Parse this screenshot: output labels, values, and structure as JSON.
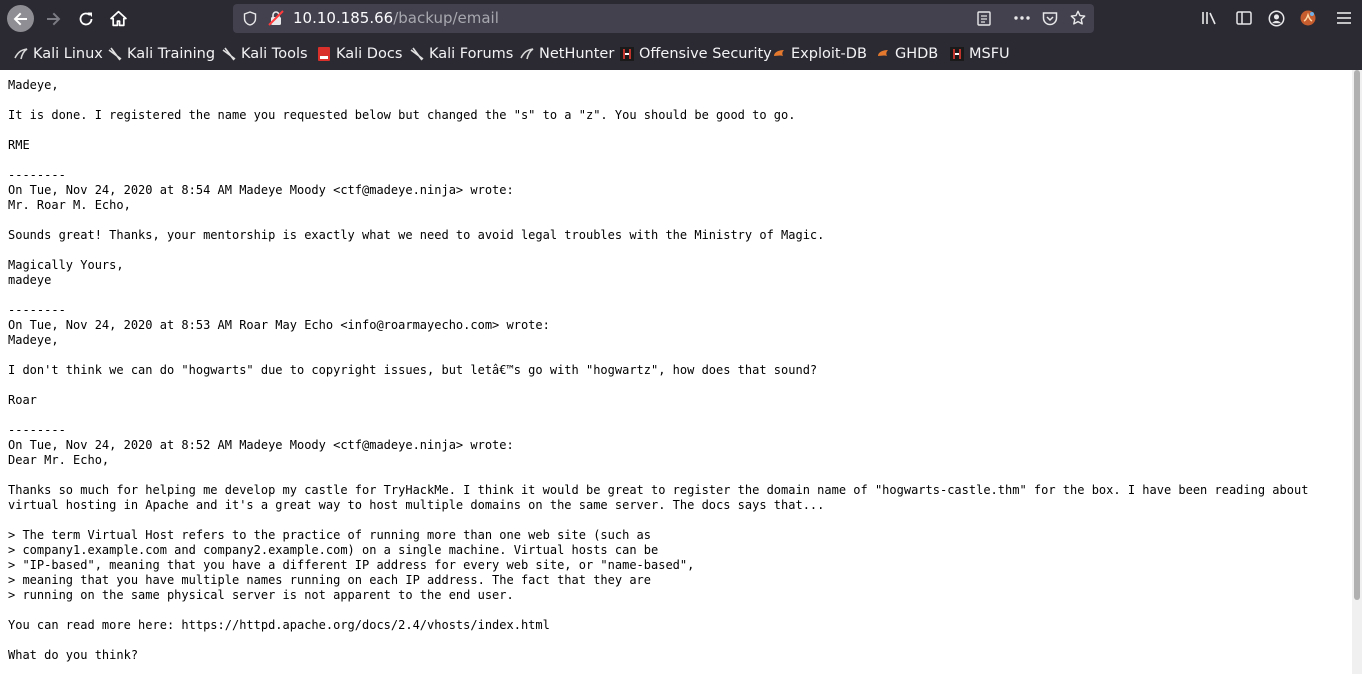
{
  "browser": {
    "url_host": "10.10.185.66",
    "url_path": "/backup/email",
    "icons": [
      "arrow-left-icon",
      "arrow-right-icon",
      "reload-icon",
      "home-icon",
      "shield-icon",
      "insecure-lock-icon",
      "reader-view-icon",
      "more-icon",
      "pocket-icon",
      "star-icon",
      "library-icon",
      "sidebar-icon",
      "account-icon",
      "extension-icon",
      "menu-icon"
    ]
  },
  "bookmarks": [
    {
      "label": "Kali Linux"
    },
    {
      "label": "Kali Training"
    },
    {
      "label": "Kali Tools"
    },
    {
      "label": "Kali Docs"
    },
    {
      "label": "Kali Forums"
    },
    {
      "label": "NetHunter"
    },
    {
      "label": "Offensive Security"
    },
    {
      "label": "Exploit-DB"
    },
    {
      "label": "GHDB"
    },
    {
      "label": "MSFU"
    }
  ],
  "email": {
    "lines": [
      "Madeye,",
      "",
      "It is done. I registered the name you requested below but changed the \"s\" to a \"z\". You should be good to go.",
      "",
      "RME",
      "",
      "--------",
      "On Tue, Nov 24, 2020 at 8:54 AM Madeye Moody <ctf@madeye.ninja> wrote:",
      "Mr. Roar M. Echo,",
      "",
      "Sounds great! Thanks, your mentorship is exactly what we need to avoid legal troubles with the Ministry of Magic.",
      "",
      "Magically Yours,",
      "madeye",
      "",
      "--------",
      "On Tue, Nov 24, 2020 at 8:53 AM Roar May Echo <info@roarmayecho.com> wrote:",
      "Madeye,",
      "",
      "I don't think we can do \"hogwarts\" due to copyright issues, but letâ€™s go with \"hogwartz\", how does that sound?",
      "",
      "Roar",
      "",
      "--------",
      "On Tue, Nov 24, 2020 at 8:52 AM Madeye Moody <ctf@madeye.ninja> wrote:",
      "Dear Mr. Echo,",
      "",
      "Thanks so much for helping me develop my castle for TryHackMe. I think it would be great to register the domain name of \"hogwarts-castle.thm\" for the box. I have been reading about",
      "virtual hosting in Apache and it's a great way to host multiple domains on the same server. The docs says that...",
      "",
      "> The term Virtual Host refers to the practice of running more than one web site (such as",
      "> company1.example.com and company2.example.com) on a single machine. Virtual hosts can be",
      "> \"IP-based\", meaning that you have a different IP address for every web site, or \"name-based\",",
      "> meaning that you have multiple names running on each IP address. The fact that they are",
      "> running on the same physical server is not apparent to the end user.",
      "",
      "You can read more here: https://httpd.apache.org/docs/2.4/vhosts/index.html",
      "",
      "What do you think?"
    ]
  }
}
